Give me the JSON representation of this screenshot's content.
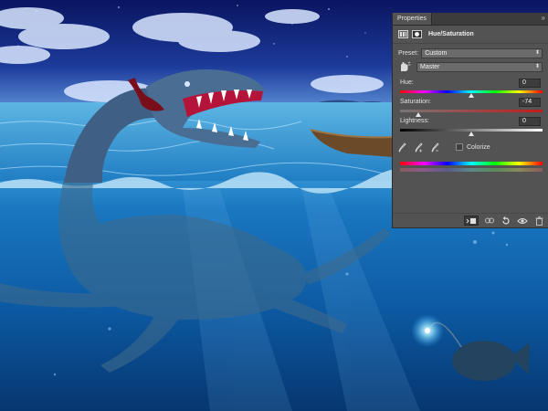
{
  "panel": {
    "tab_label": "Properties",
    "collapse_glyph": "»",
    "header_icons": [
      "adjustment-grid-icon",
      "layer-mask-icon"
    ],
    "title": "Hue/Saturation"
  },
  "preset": {
    "label": "Preset:",
    "value": "Custom"
  },
  "channel": {
    "icon": "hand-target-icon",
    "value": "Master"
  },
  "sliders": {
    "hue": {
      "label": "Hue:",
      "value": "0",
      "position": 0.5
    },
    "saturation": {
      "label": "Saturation:",
      "value": "-74",
      "position": 0.13
    },
    "lightness": {
      "label": "Lightness:",
      "value": "0",
      "position": 0.5
    }
  },
  "tools": {
    "eyedroppers": [
      "eyedropper-icon",
      "eyedropper-plus-icon",
      "eyedropper-minus-icon"
    ],
    "colorize_label": "Colorize",
    "colorize_checked": false
  },
  "bottom_icons": [
    "clip-to-layer-icon",
    "view-previous-icon",
    "reset-icon",
    "visibility-eye-icon",
    "trash-icon"
  ],
  "colors": {
    "panel_bg": "#535353",
    "tab_bar_bg": "#3c3c3c",
    "sky_top": "#0b1d6b",
    "sea": "#0d5fa8"
  }
}
